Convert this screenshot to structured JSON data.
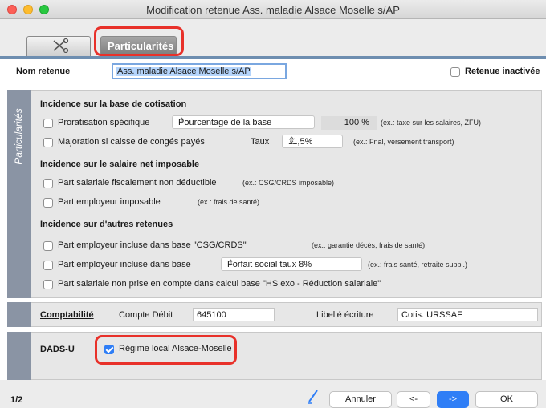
{
  "window": {
    "title": "Modification retenue Ass. maladie Alsace Moselle s/AP"
  },
  "tabs": [
    {
      "label": "",
      "icon": "scissors-icon"
    },
    {
      "label": "Particularités"
    }
  ],
  "header": {
    "name_label": "Nom retenue",
    "name_value": "Ass. maladie Alsace Moselle s/AP",
    "inactive_label": "Retenue inactivée",
    "inactive_checked": false
  },
  "particularites": {
    "side_label": "Particularités",
    "base_cotisation": {
      "title": "Incidence sur la base de cotisation",
      "proratisation_label": "Proratisation spécifique",
      "proratisation_select": "Pourcentage de la base",
      "proratisation_percent": "100 %",
      "proratisation_hint": "(ex.: taxe sur les salaires, ZFU)",
      "majoration_label": "Majoration si caisse de congés payés",
      "taux_label": "Taux",
      "taux_value": "11,5%",
      "majoration_hint": "(ex.: Fnal, versement transport)"
    },
    "net_imposable": {
      "title": "Incidence sur le salaire net imposable",
      "part_salariale_label": "Part salariale fiscalement non déductible",
      "part_salariale_hint": "(ex.: CSG/CRDS imposable)",
      "part_employeur_label": "Part employeur imposable",
      "part_employeur_hint": "(ex.: frais de santé)"
    },
    "autres_retenues": {
      "title": "Incidence sur d'autres retenues",
      "csg_label": "Part employeur incluse dans base \"CSG/CRDS\"",
      "csg_hint": "(ex.: garantie décès, frais de santé)",
      "base_label": "Part employeur incluse dans base",
      "base_select": "Forfait social taux 8%",
      "base_hint": "(ex.: frais santé, retraite suppl.)",
      "hs_label": "Part salariale non prise en compte dans calcul base \"HS exo - Réduction salariale\""
    }
  },
  "comptabilite": {
    "title": "Comptabilité",
    "compte_label": "Compte Débit",
    "compte_value": "645100",
    "libelle_label": "Libellé écriture",
    "libelle_value": "Cotis. URSSAF"
  },
  "dads": {
    "title": "DADS-U",
    "regime_label": "Régime local Alsace-Moselle",
    "regime_checked": true
  },
  "footer": {
    "page_indicator": "1/2",
    "cancel_label": "Annuler",
    "prev_label": "<-",
    "next_label": "->",
    "ok_label": "OK"
  },
  "colors": {
    "accent": "#2f7ef6",
    "highlight": "#e8312a",
    "sidebar": "#8a94a4"
  }
}
